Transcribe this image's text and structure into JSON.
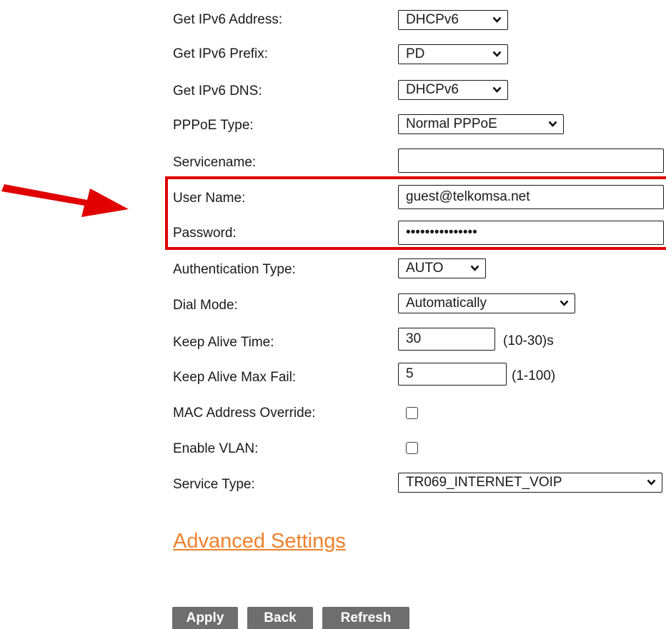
{
  "form": {
    "ipv6_address": {
      "label": "Get IPv6 Address:",
      "value": "DHCPv6"
    },
    "ipv6_prefix": {
      "label": "Get IPv6 Prefix:",
      "value": "PD"
    },
    "ipv6_dns": {
      "label": "Get IPv6 DNS:",
      "value": "DHCPv6"
    },
    "pppoe_type": {
      "label": "PPPoE Type:",
      "value": "Normal PPPoE"
    },
    "servicename": {
      "label": "Servicename:",
      "value": ""
    },
    "username": {
      "label": "User Name:",
      "value": "guest@telkomsa.net"
    },
    "password": {
      "label": "Password:",
      "value": "•••••••••••••••"
    },
    "auth_type": {
      "label": "Authentication Type:",
      "value": "AUTO"
    },
    "dial_mode": {
      "label": "Dial Mode:",
      "value": "Automatically"
    },
    "keep_alive_time": {
      "label": "Keep Alive Time:",
      "value": "30",
      "unit": "(10-30)s"
    },
    "keep_alive_max_fail": {
      "label": "Keep Alive Max Fail:",
      "value": "5",
      "unit": "(1-100)"
    },
    "mac_override": {
      "label": "MAC Address Override:",
      "checked": false
    },
    "enable_vlan": {
      "label": "Enable VLAN:",
      "checked": false
    },
    "service_type": {
      "label": "Service Type:",
      "value": "TR069_INTERNET_VOIP"
    }
  },
  "advanced_settings_link": "Advanced Settings",
  "buttons": {
    "apply": "Apply",
    "back": "Back",
    "refresh": "Refresh"
  },
  "colors": {
    "highlight": "#e00000",
    "link": "#f0812a",
    "button": "#6e6e6e"
  }
}
